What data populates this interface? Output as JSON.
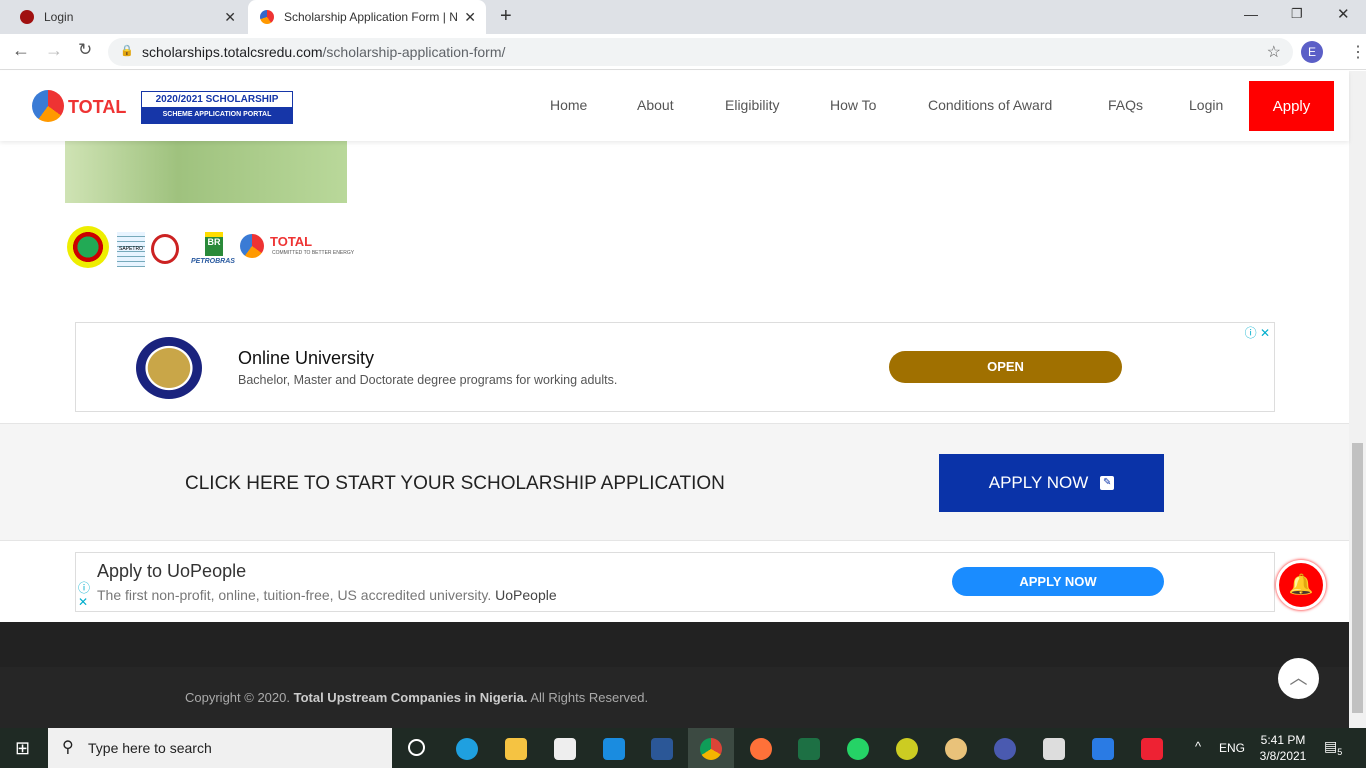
{
  "browser": {
    "tabs": [
      {
        "title": "Login"
      },
      {
        "title": "Scholarship Application Form | N"
      }
    ],
    "url_host": "scholarships.totalcsredu.com",
    "url_path": "/scholarship-application-form/",
    "profile": "E"
  },
  "header": {
    "logo_text": "TOTAL",
    "badge_line1": "2020/2021 SCHOLARSHIP",
    "badge_line2": "SCHEME APPLICATION PORTAL",
    "nav": [
      "Home",
      "About",
      "Eligibility",
      "How To",
      "Conditions of Award",
      "FAQs",
      "Login"
    ],
    "apply": "Apply"
  },
  "partners": {
    "sapetro": "SAPETRO",
    "petrobras": "PETROBRAS",
    "total": "TOTAL",
    "total_tag": "COMMITTED TO BETTER ENERGY"
  },
  "ad1": {
    "title": "Online University",
    "desc": "Bachelor, Master and Doctorate degree programs for working adults.",
    "button": "OPEN"
  },
  "cta": {
    "text": "CLICK HERE TO START YOUR SCHOLARSHIP APPLICATION",
    "button": "APPLY NOW"
  },
  "ad2": {
    "title": "Apply to UoPeople",
    "desc": "The first non-profit, online, tuition-free, US accredited university.",
    "brand": "UoPeople",
    "button": "APPLY NOW"
  },
  "footer": {
    "prefix": "Copyright © 2020.",
    "company": "Total Upstream Companies in Nigeria.",
    "suffix": "All Rights Reserved."
  },
  "taskbar": {
    "search": "Type here to search",
    "lang": "ENG",
    "time": "5:41 PM",
    "date": "3/8/2021",
    "notifications": "5"
  }
}
